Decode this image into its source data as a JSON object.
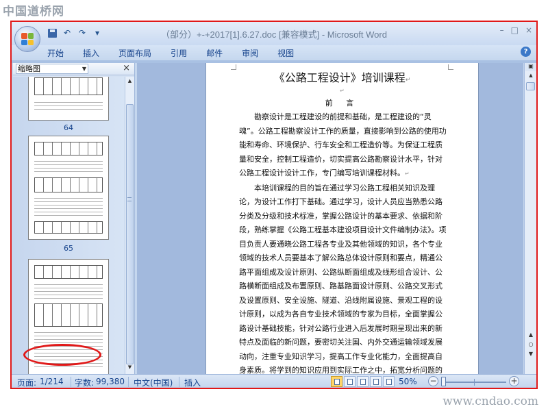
{
  "watermarks": {
    "top": "中国道桥网",
    "bottom": "www.cndao.com"
  },
  "window": {
    "title": "（部分）+-+2017[1].6.27.doc [兼容模式] - Microsoft Word",
    "controls": [
      "–",
      "□",
      "×"
    ]
  },
  "qat": {
    "undo_glyph": "↶",
    "redo_glyph": "↷",
    "dropdown": "▾"
  },
  "ribbon": {
    "tabs": [
      "开始",
      "插入",
      "页面布局",
      "引用",
      "邮件",
      "审阅",
      "视图"
    ],
    "help": "?"
  },
  "nav_pane": {
    "mode": "缩略图",
    "close": "×",
    "thumb_labels": [
      "64",
      "65"
    ]
  },
  "page": {
    "title": "《公路工程设计》培训课程",
    "subtitle": "前 言",
    "paragraphs": [
      "勘察设计是工程建设的前提和基础，是工程建设的“灵魂”。公路工程勘察设计工作的质量，直接影响到公路的使用功能和寿命、环境保护、行车安全和工程造价等。为保证工程质量和安全，控制工程造价，切实提高公路勘察设计水平，针对公路工程设计设计工作，专门编写培训课程材料。",
      "本培训课程的目的旨在通过学习公路工程相关知识及理论，为设计工作打下基础。通过学习，设计人员应当熟悉公路分类及分级和技术标准，掌握公路设计的基本要求、依据和阶段，熟练掌握《公路工程基本建设项目设计文件编制办法》。项目负责人要通晓公路工程各专业及其他领域的知识，各个专业领域的技术人员要基本了解公路总体设计原则和要点，精通公路平面组成及设计原则、公路纵断面组成及线形组合设计、公路横断面组成及布置原则、路基路面设计原则、公路交叉形式及设置原则、安全设施、隧道、沿线附属设施、景观工程的设计原则，以成为各自专业技术领域的专家为目标，全面掌握公路设计基础技能，针对公路行业进入后发展时期呈现出来的新特点及面临的新问题，要密切关注国、内外交通运输领域发展动向，注重专业知识学习，提高工作专业化能力，全面提高自身素质。将学到的知识应用到实际工作之中，拓宽分析问题的思路，提高处理问题、解决问题的能力，增强公路设计水平。"
    ]
  },
  "status": {
    "page_label": "页面:",
    "page_value": "1/214",
    "words_label": "字数:",
    "words_value": "99,380",
    "language": "中文(中国)",
    "insert_mode": "插入",
    "zoom": "50%",
    "zoom_level_fraction": 0.5
  },
  "colors": {
    "highlight": "#e01818",
    "ribbon_text": "#15428b"
  }
}
